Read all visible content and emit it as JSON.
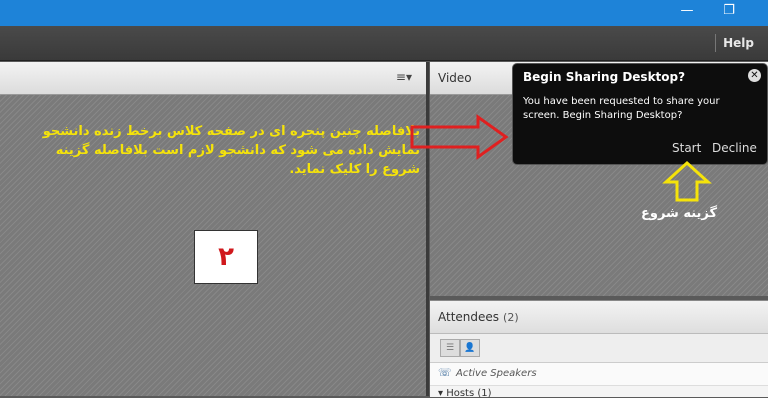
{
  "window": {
    "minimize_glyph": "—",
    "restore_glyph": "❐"
  },
  "menubar": {
    "help_label": "Help"
  },
  "left_pod": {
    "menu_icon": "menu-icon",
    "instruction_text": "بلافاصله چنین پنجره ای در صفحه کلاس برخط زنده دانشجو نمایش داده می شود که دانشجو لازم است بلافاصله گزینه شروع را کلیک نماید.",
    "step_number": "۲"
  },
  "video_pod": {
    "title": "Video"
  },
  "attendees": {
    "title": "Attendees",
    "count": "(2)",
    "active_speakers_label": "Active Speakers",
    "hosts_label": "Hosts (1)"
  },
  "popup": {
    "title": "Begin Sharing Desktop?",
    "message": "You have been requested to share your screen. Begin Sharing Desktop?",
    "start_label": "Start",
    "decline_label": "Decline"
  },
  "annotations": {
    "option_label": "گزینه شروع",
    "arrow_red_color": "#e02020",
    "arrow_yellow_color": "#f5e30a"
  }
}
